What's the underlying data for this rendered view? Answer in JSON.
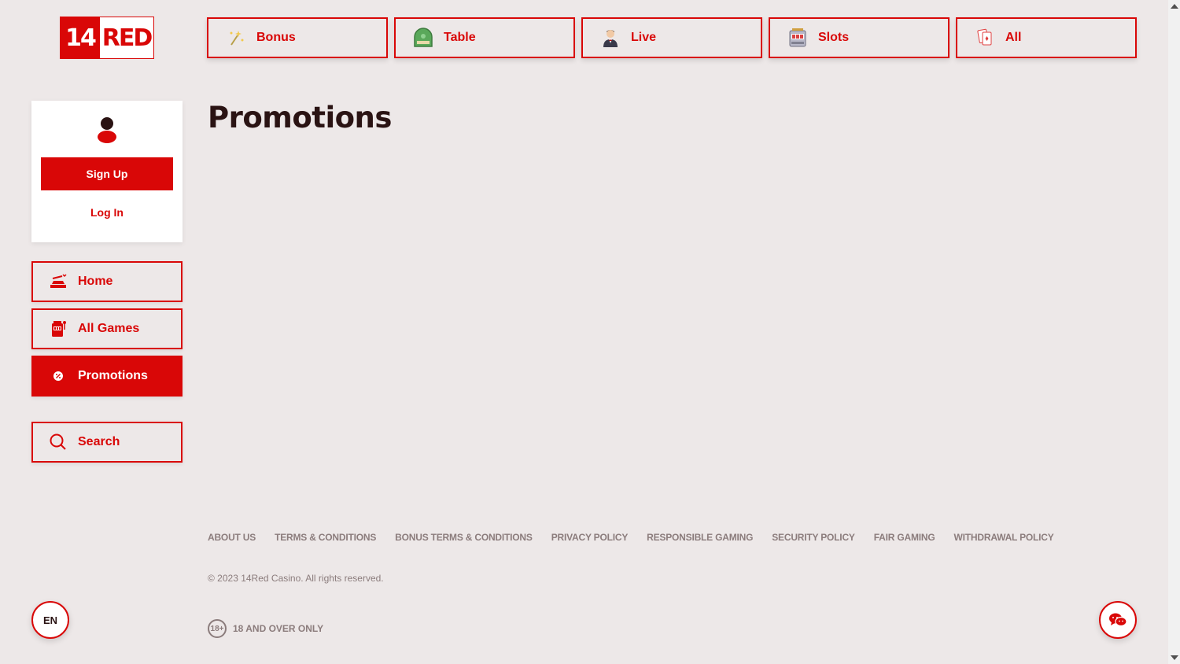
{
  "logo": {
    "number": "14",
    "word": "RED"
  },
  "categories": [
    {
      "label": "Bonus",
      "icon": "sparkle-wand-icon"
    },
    {
      "label": "Table",
      "icon": "roulette-table-icon"
    },
    {
      "label": "Live",
      "icon": "dealer-icon"
    },
    {
      "label": "Slots",
      "icon": "slot-machine-icon"
    },
    {
      "label": "All",
      "icon": "playing-cards-icon"
    }
  ],
  "user": {
    "signup_label": "Sign Up",
    "login_label": "Log In"
  },
  "nav": [
    {
      "label": "Home",
      "icon": "home-icon",
      "active": false
    },
    {
      "label": "All Games",
      "icon": "slot-machine-icon",
      "active": false
    },
    {
      "label": "Promotions",
      "icon": "promo-icon",
      "active": true
    }
  ],
  "search": {
    "label": "Search"
  },
  "main": {
    "title": "Promotions"
  },
  "footer": {
    "links": [
      "ABOUT US",
      "TERMS & CONDITIONS",
      "BONUS TERMS & CONDITIONS",
      "PRIVACY POLICY",
      "RESPONSIBLE GAMING",
      "SECURITY POLICY",
      "FAIR GAMING",
      "WITHDRAWAL POLICY"
    ],
    "copyright": "© 2023 14Red Casino. All rights reserved.",
    "age_badge": "18+",
    "age_text": "18 AND OVER ONLY"
  },
  "language": {
    "code": "EN"
  },
  "colors": {
    "accent": "#d90707",
    "background": "#ede8e8",
    "text": "#2a1313",
    "muted": "#8b7c7c"
  }
}
